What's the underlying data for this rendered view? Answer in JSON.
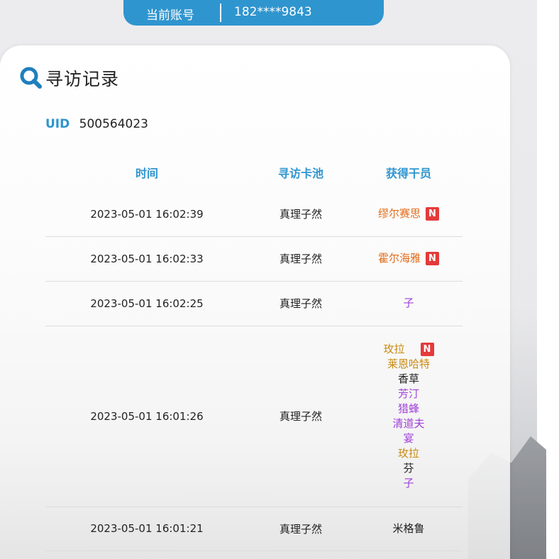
{
  "account": {
    "label": "当前账号",
    "value": "182****9843"
  },
  "page": {
    "title": "寻访记录",
    "icon": "search-icon"
  },
  "uid": {
    "label": "UID",
    "value": "500564023"
  },
  "table": {
    "headers": [
      "时间",
      "寻访卡池",
      "获得干员"
    ],
    "new_badge": "N",
    "rows": [
      {
        "time": "2023-05-01 16:02:39",
        "pool": "真理子然",
        "operators": [
          {
            "name": "缪尔赛思",
            "color": "#e36c1b",
            "new": true
          }
        ]
      },
      {
        "time": "2023-05-01 16:02:33",
        "pool": "真理子然",
        "operators": [
          {
            "name": "霍尔海雅",
            "color": "#e36c1b",
            "new": true
          }
        ]
      },
      {
        "time": "2023-05-01 16:02:25",
        "pool": "真理子然",
        "operators": [
          {
            "name": "子",
            "color": "#a040d8",
            "new": false
          }
        ]
      },
      {
        "time": "2023-05-01 16:01:26",
        "pool": "真理子然",
        "operators": [
          {
            "name": "玫拉",
            "color": "#c98a10",
            "new": true
          },
          {
            "name": "莱恩哈特",
            "color": "#c98a10",
            "new": false
          },
          {
            "name": "香草",
            "color": "#222222",
            "new": false
          },
          {
            "name": "芳汀",
            "color": "#a040d8",
            "new": false
          },
          {
            "name": "猎蜂",
            "color": "#a040d8",
            "new": false
          },
          {
            "name": "清道夫",
            "color": "#a040d8",
            "new": false
          },
          {
            "name": "宴",
            "color": "#a040d8",
            "new": false
          },
          {
            "name": "玫拉",
            "color": "#c98a10",
            "new": false
          },
          {
            "name": "芬",
            "color": "#222222",
            "new": false
          },
          {
            "name": "子",
            "color": "#a040d8",
            "new": false
          }
        ]
      },
      {
        "time": "2023-05-01 16:01:21",
        "pool": "真理子然",
        "operators": [
          {
            "name": "米格鲁",
            "color": "#222222",
            "new": false
          }
        ]
      }
    ]
  },
  "colors": {
    "accent": "#2f95cf",
    "badge": "#e43a3a"
  }
}
